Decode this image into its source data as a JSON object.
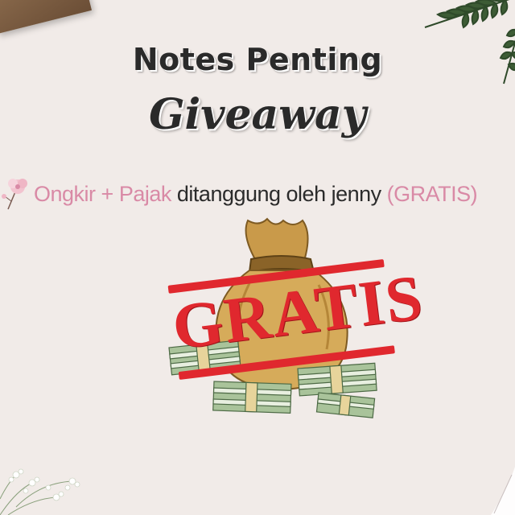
{
  "title": {
    "line1": "Notes Penting",
    "line2": "Giveaway"
  },
  "note": {
    "ongkir": "Ongkir",
    "plus": "+",
    "pajak": "Pajak",
    "middle": "ditanggung oleh jenny",
    "gratis_paren": "(GRATIS)"
  },
  "stamp": {
    "text": "GRATIS"
  },
  "colors": {
    "background": "#f1ebe8",
    "pink_text": "#d98aa6",
    "dark_text": "#2b2b2b",
    "stamp_red": "#e0282e"
  },
  "icons": [
    "fern-leaf",
    "baby-breath-flowers",
    "pink-flower",
    "money-bag",
    "cash-stacks"
  ]
}
